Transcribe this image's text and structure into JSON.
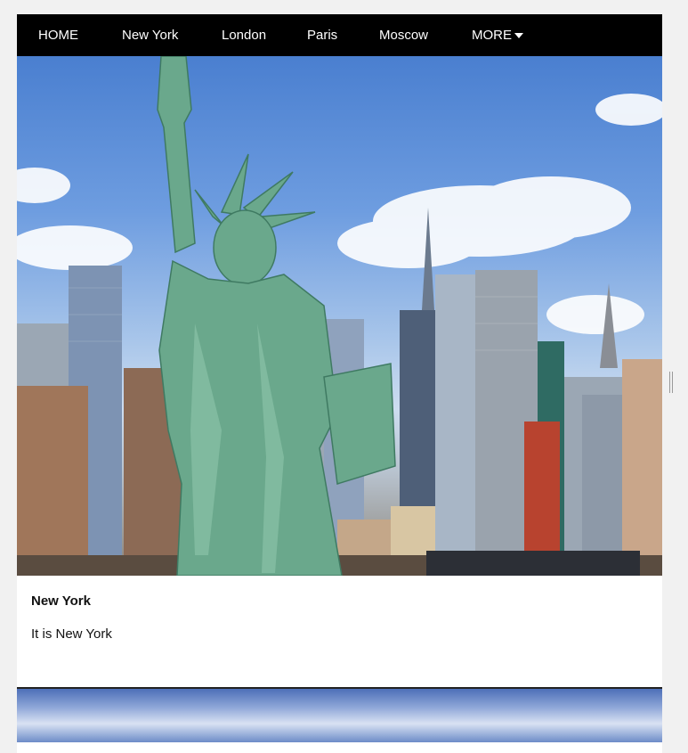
{
  "nav": {
    "items": [
      {
        "label": "HOME"
      },
      {
        "label": "New York"
      },
      {
        "label": "London"
      },
      {
        "label": "Paris"
      },
      {
        "label": "Moscow"
      }
    ],
    "more_label": "MORE",
    "more_icon": "caret-down-icon"
  },
  "card": {
    "image": "statue-of-liberty-new-york-skyline",
    "title": "New York",
    "text": "It is New York"
  },
  "colors": {
    "navbar_bg": "#000000",
    "nav_text": "#ffffff",
    "page_bg": "#f1f1f1",
    "card_bg": "#ffffff"
  }
}
